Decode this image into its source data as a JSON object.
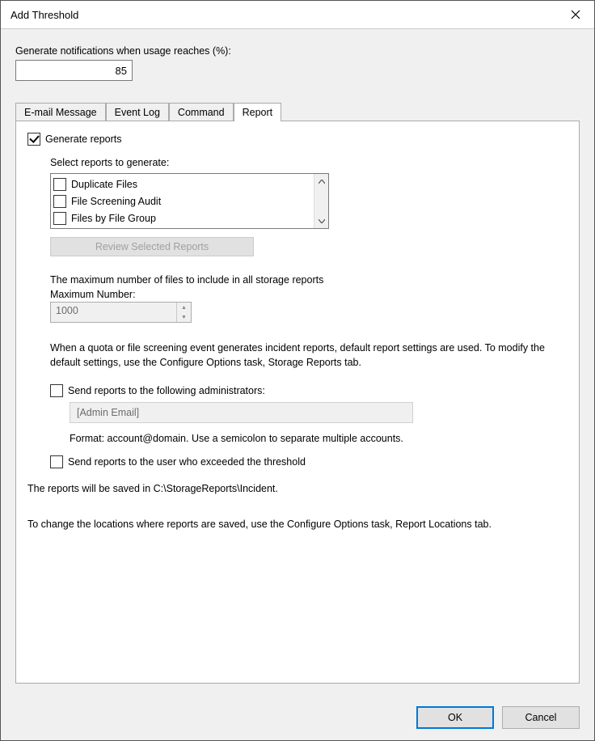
{
  "window": {
    "title": "Add Threshold"
  },
  "usage": {
    "label": "Generate notifications when usage reaches (%):",
    "value": "85"
  },
  "tabs": {
    "email": "E-mail Message",
    "eventlog": "Event Log",
    "command": "Command",
    "report": "Report"
  },
  "report": {
    "generate_label": "Generate reports",
    "select_label": "Select reports to generate:",
    "items": {
      "0": "Duplicate Files",
      "1": "File Screening Audit",
      "2": "Files by File Group"
    },
    "review_btn": "Review Selected Reports",
    "max_desc": "The maximum number of files to include in all storage reports",
    "max_label": "Maximum Number:",
    "max_value": "1000",
    "defaults_text": "When a quota or file screening event generates incident reports, default report settings are used. To modify the default settings, use the Configure Options task, Storage Reports tab.",
    "send_admin_label": "Send reports to the following administrators:",
    "admin_placeholder": "[Admin Email]",
    "format_hint": "Format: account@domain. Use a semicolon to separate multiple accounts.",
    "send_user_label": "Send reports to the user who exceeded the threshold",
    "saved_text": "The reports will be saved in C:\\StorageReports\\Incident.",
    "locations_text": "To change the locations where reports are saved, use the Configure Options task, Report Locations tab."
  },
  "buttons": {
    "ok": "OK",
    "cancel": "Cancel"
  }
}
